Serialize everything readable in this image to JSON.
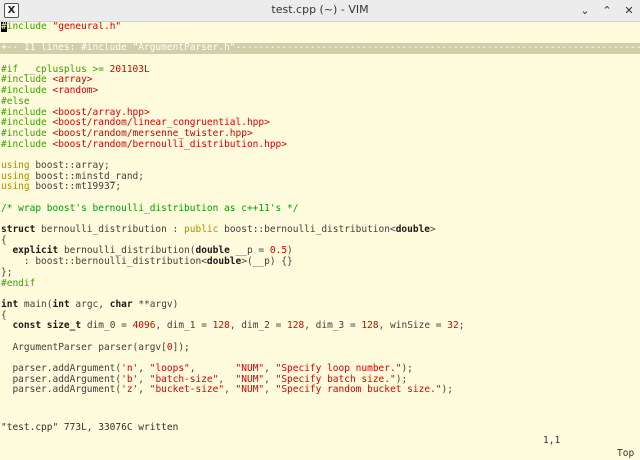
{
  "window": {
    "title": "test.cpp (~) - VIM",
    "app_icon": "X",
    "controls": [
      "⌄",
      "⌃",
      "✕"
    ]
  },
  "editor": {
    "lines": [
      [
        [
          "pp",
          "#include "
        ],
        [
          "str",
          "\"geneural.h\""
        ]
      ],
      [
        [
          "pl",
          ""
        ]
      ],
      [
        [
          "fold",
          "+-- 11 lines: #include \"ArgumentParser.h\"------------------------------------------------------------------------------------------"
        ]
      ],
      [
        [
          "pl",
          ""
        ]
      ],
      [
        [
          "pp",
          "#if __cplusplus >= "
        ],
        [
          "str",
          "201103L"
        ]
      ],
      [
        [
          "pp",
          "#include "
        ],
        [
          "str",
          "<array>"
        ]
      ],
      [
        [
          "pp",
          "#include "
        ],
        [
          "str",
          "<random>"
        ]
      ],
      [
        [
          "pp",
          "#else"
        ]
      ],
      [
        [
          "pp",
          "#include "
        ],
        [
          "str",
          "<boost/array.hpp>"
        ]
      ],
      [
        [
          "pp",
          "#include "
        ],
        [
          "str",
          "<boost/random/linear_congruential.hpp>"
        ]
      ],
      [
        [
          "pp",
          "#include "
        ],
        [
          "str",
          "<boost/random/mersenne_twister.hpp>"
        ]
      ],
      [
        [
          "pp",
          "#include "
        ],
        [
          "str",
          "<boost/random/bernoulli_distribution.hpp>"
        ]
      ],
      [
        [
          "pl",
          ""
        ]
      ],
      [
        [
          "ty",
          "using "
        ],
        [
          "pl",
          "boost::array;"
        ]
      ],
      [
        [
          "ty",
          "using "
        ],
        [
          "pl",
          "boost::minstd_rand;"
        ]
      ],
      [
        [
          "ty",
          "using "
        ],
        [
          "pl",
          "boost::mt19937;"
        ]
      ],
      [
        [
          "pl",
          ""
        ]
      ],
      [
        [
          "cm",
          "/* wrap boost's bernoulli_distribution as c++11's */"
        ]
      ],
      [
        [
          "pl",
          ""
        ]
      ],
      [
        [
          "kw",
          "struct "
        ],
        [
          "pl",
          "bernoulli_distribution : "
        ],
        [
          "ty",
          "public "
        ],
        [
          "pl",
          "boost::bernoulli_distribution<"
        ],
        [
          "kw",
          "double"
        ],
        [
          "pl",
          ">"
        ]
      ],
      [
        [
          "pl",
          "{"
        ]
      ],
      [
        [
          "pl",
          "  "
        ],
        [
          "kw",
          "explicit "
        ],
        [
          "pl",
          "bernoulli_distribution("
        ],
        [
          "kw",
          "double "
        ],
        [
          "pl",
          "__p = "
        ],
        [
          "num",
          "0.5"
        ],
        [
          "pl",
          ")"
        ]
      ],
      [
        [
          "pl",
          "    : boost::bernoulli_distribution<"
        ],
        [
          "kw",
          "double"
        ],
        [
          "pl",
          ">(__p) {}"
        ]
      ],
      [
        [
          "pl",
          "};"
        ]
      ],
      [
        [
          "pp",
          "#endif"
        ]
      ],
      [
        [
          "pl",
          ""
        ]
      ],
      [
        [
          "kw",
          "int "
        ],
        [
          "pl",
          "main("
        ],
        [
          "kw",
          "int "
        ],
        [
          "pl",
          "argc, "
        ],
        [
          "kw",
          "char "
        ],
        [
          "pl",
          "**argv)"
        ]
      ],
      [
        [
          "pl",
          "{"
        ]
      ],
      [
        [
          "pl",
          "  "
        ],
        [
          "kw",
          "const size_t "
        ],
        [
          "pl",
          "dim_0 = "
        ],
        [
          "num",
          "4096"
        ],
        [
          "pl",
          ", dim_1 = "
        ],
        [
          "num",
          "128"
        ],
        [
          "pl",
          ", dim_2 = "
        ],
        [
          "num",
          "128"
        ],
        [
          "pl",
          ", dim_3 = "
        ],
        [
          "num",
          "128"
        ],
        [
          "pl",
          ", winSize = "
        ],
        [
          "num",
          "32"
        ],
        [
          "pl",
          ";"
        ]
      ],
      [
        [
          "pl",
          ""
        ]
      ],
      [
        [
          "pl",
          "  ArgumentParser parser(argv["
        ],
        [
          "num",
          "0"
        ],
        [
          "pl",
          "]);"
        ]
      ],
      [
        [
          "pl",
          ""
        ]
      ],
      [
        [
          "pl",
          "  parser.addArgument("
        ],
        [
          "str",
          "'n'"
        ],
        [
          "pl",
          ", "
        ],
        [
          "str",
          "\"loops\""
        ],
        [
          "pl",
          ",       "
        ],
        [
          "str",
          "\"NUM\""
        ],
        [
          "pl",
          ", "
        ],
        [
          "str",
          "\"Specify loop number.\""
        ],
        [
          "pl",
          ");"
        ]
      ],
      [
        [
          "pl",
          "  parser.addArgument("
        ],
        [
          "str",
          "'b'"
        ],
        [
          "pl",
          ", "
        ],
        [
          "str",
          "\"batch-size\""
        ],
        [
          "pl",
          ",  "
        ],
        [
          "str",
          "\"NUM\""
        ],
        [
          "pl",
          ", "
        ],
        [
          "str",
          "\"Specify batch size.\""
        ],
        [
          "pl",
          ");"
        ]
      ],
      [
        [
          "pl",
          "  parser.addArgument("
        ],
        [
          "str",
          "'z'"
        ],
        [
          "pl",
          ", "
        ],
        [
          "str",
          "\"bucket-size\""
        ],
        [
          "pl",
          ", "
        ],
        [
          "str",
          "\"NUM\""
        ],
        [
          "pl",
          ", "
        ],
        [
          "str",
          "\"Specify random bucket size.\""
        ],
        [
          "pl",
          ");"
        ]
      ]
    ]
  },
  "statusline": {
    "message": "\"test.cpp\" 773L, 33076C written",
    "position": "1,1",
    "percent": "Top"
  }
}
